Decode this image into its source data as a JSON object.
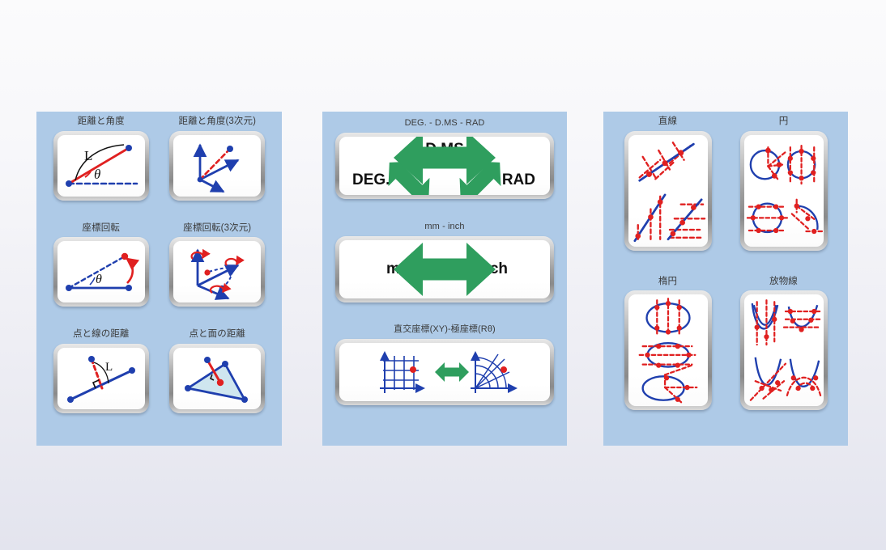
{
  "app": {
    "background_top": "#fbfbfc",
    "background_bottom": "#e3e4ee",
    "panel_color": "#aecae7",
    "accent_green": "#2f9e5e",
    "accent_red": "#e02020",
    "accent_blue": "#1f3fae"
  },
  "panels": [
    {
      "id": "geometry",
      "tiles": [
        {
          "label": "距離と角度",
          "icon": "distance-angle-2d-icon"
        },
        {
          "label": "距離と角度(3次元)",
          "icon": "distance-angle-3d-icon"
        },
        {
          "label": "座標回転",
          "icon": "coordinate-rotation-2d-icon"
        },
        {
          "label": "座標回転(3次元)",
          "icon": "coordinate-rotation-3d-icon"
        },
        {
          "label": "点と線の距離",
          "icon": "point-line-distance-icon"
        },
        {
          "label": "点と面の距離",
          "icon": "point-plane-distance-icon"
        }
      ],
      "glyphs": {
        "length": "L",
        "theta": "θ"
      }
    },
    {
      "id": "conversion",
      "tiles": [
        {
          "label": "DEG. - D.MS - RAD",
          "icon": "angle-unit-conversion-icon",
          "values": {
            "top": "D.MS",
            "left": "DEG.",
            "right": "RAD"
          }
        },
        {
          "label": "mm - inch",
          "icon": "length-unit-conversion-icon",
          "values": {
            "left": "mm",
            "right": "inch"
          }
        },
        {
          "label": "直交座標(XY)-極座標(Rθ)",
          "icon": "cartesian-polar-conversion-icon",
          "values": {}
        }
      ]
    },
    {
      "id": "curves",
      "tiles": [
        {
          "label": "直線",
          "icon": "line-intersections-icon"
        },
        {
          "label": "円",
          "icon": "circle-intersections-icon"
        },
        {
          "label": "楕円",
          "icon": "ellipse-intersections-icon"
        },
        {
          "label": "放物線",
          "icon": "parabola-intersections-icon"
        }
      ]
    }
  ]
}
